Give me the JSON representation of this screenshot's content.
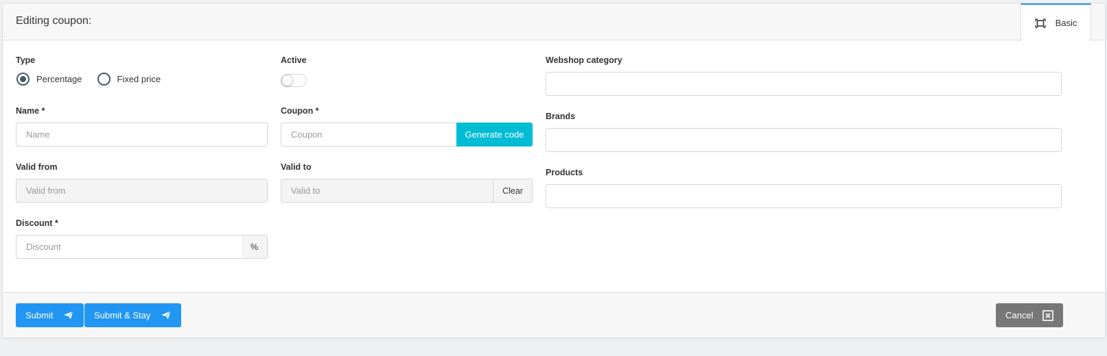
{
  "header": {
    "title": "Editing coupon:",
    "tab_basic": "Basic"
  },
  "form": {
    "type": {
      "label": "Type",
      "options": [
        {
          "label": "Percentage",
          "checked": true
        },
        {
          "label": "Fixed price",
          "checked": false
        }
      ]
    },
    "active": {
      "label": "Active",
      "on": false
    },
    "name": {
      "label": "Name *",
      "placeholder": "Name",
      "value": ""
    },
    "coupon": {
      "label": "Coupon *",
      "placeholder": "Coupon",
      "value": "",
      "generate_label": "Generate code"
    },
    "valid_from": {
      "label": "Valid from",
      "placeholder": "Valid from",
      "value": ""
    },
    "valid_to": {
      "label": "Valid to",
      "placeholder": "Valid to",
      "value": "",
      "clear_label": "Clear"
    },
    "discount": {
      "label": "Discount *",
      "placeholder": "Discount",
      "value": "",
      "unit": "%"
    },
    "webshop_category": {
      "label": "Webshop category",
      "value": ""
    },
    "brands": {
      "label": "Brands",
      "value": ""
    },
    "products": {
      "label": "Products",
      "value": ""
    }
  },
  "footer": {
    "submit_label": "Submit",
    "submit_stay_label": "Submit & Stay",
    "cancel_label": "Cancel"
  },
  "icons": {
    "tab": "expand-icon",
    "submit": "paper-plane-icon",
    "cancel": "close-box-icon"
  },
  "colors": {
    "primary": "#2196f3",
    "info": "#00bcd4",
    "secondary": "#777777",
    "radio": "#455a64"
  }
}
